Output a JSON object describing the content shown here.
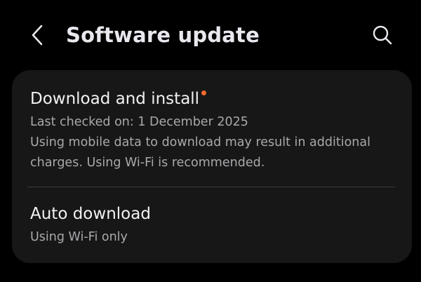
{
  "header": {
    "title": "Software update",
    "back_icon": "chevron-left-icon",
    "search_icon": "search-icon"
  },
  "items": [
    {
      "title": "Download and install",
      "has_badge": true,
      "badge_color": "#f2692e",
      "subtitle": "Last checked on: 1 December 2025",
      "description": "Using mobile data to download may result in additional charges. Using Wi-Fi is recommended."
    },
    {
      "title": "Auto download",
      "subtitle": "Using Wi-Fi only"
    }
  ],
  "colors": {
    "background": "#000000",
    "card": "#171717",
    "title_text": "#f2f2f2",
    "secondary_text": "#a9a9ad"
  }
}
